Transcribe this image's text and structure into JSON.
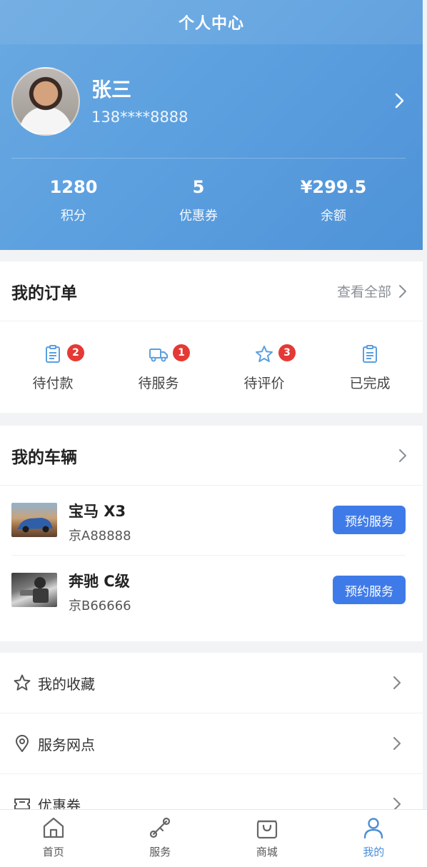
{
  "header": {
    "title": "个人中心"
  },
  "profile": {
    "name": "张三",
    "phone": "138****8888"
  },
  "stats": [
    {
      "value": "1280",
      "label": "积分"
    },
    {
      "value": "5",
      "label": "优惠券"
    },
    {
      "value": "¥299.5",
      "label": "余额"
    }
  ],
  "orders": {
    "title": "我的订单",
    "view_all": "查看全部",
    "items": [
      {
        "label": "待付款",
        "badge": "2",
        "icon": "clipboard-icon"
      },
      {
        "label": "待服务",
        "badge": "1",
        "icon": "truck-icon"
      },
      {
        "label": "待评价",
        "badge": "3",
        "icon": "star-icon"
      },
      {
        "label": "已完成",
        "badge": "",
        "icon": "clipboard-icon"
      }
    ]
  },
  "vehicles": {
    "title": "我的车辆",
    "items": [
      {
        "name": "宝马 X3",
        "plate": "京A88888",
        "button": "预约服务"
      },
      {
        "name": "奔驰 C级",
        "plate": "京B66666",
        "button": "预约服务"
      }
    ]
  },
  "menu": [
    {
      "label": "我的收藏",
      "icon": "star-outline-icon"
    },
    {
      "label": "服务网点",
      "icon": "location-pin-icon"
    },
    {
      "label": "优惠券",
      "icon": "ticket-icon"
    }
  ],
  "tabs": [
    {
      "label": "首页",
      "icon": "home-icon",
      "active": false
    },
    {
      "label": "服务",
      "icon": "wrench-icon",
      "active": false
    },
    {
      "label": "商城",
      "icon": "shopping-bag-icon",
      "active": false
    },
    {
      "label": "我的",
      "icon": "user-icon",
      "active": true
    }
  ],
  "colors": {
    "header": "#5b9fdf",
    "accent": "#3f7be8",
    "badge": "#e53935",
    "tab_active": "#4a8fd8"
  }
}
